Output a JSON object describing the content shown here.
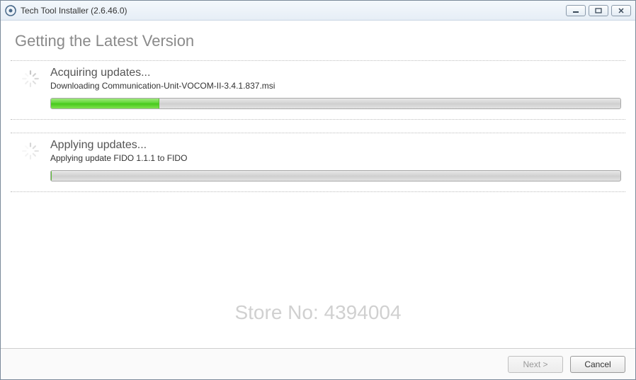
{
  "window": {
    "title": "Tech Tool Installer (2.6.46.0)"
  },
  "page": {
    "heading": "Getting the Latest Version"
  },
  "sections": {
    "acquire": {
      "title": "Acquiring updates...",
      "sub": "Downloading Communication-Unit-VOCOM-II-3.4.1.837.msi",
      "progress": 19
    },
    "apply": {
      "title": "Applying updates...",
      "sub": "Applying update FIDO 1.1.1 to FIDO",
      "progress": 0
    }
  },
  "footer": {
    "next": "Next >",
    "cancel": "Cancel"
  },
  "watermark": "Store No: 4394004"
}
